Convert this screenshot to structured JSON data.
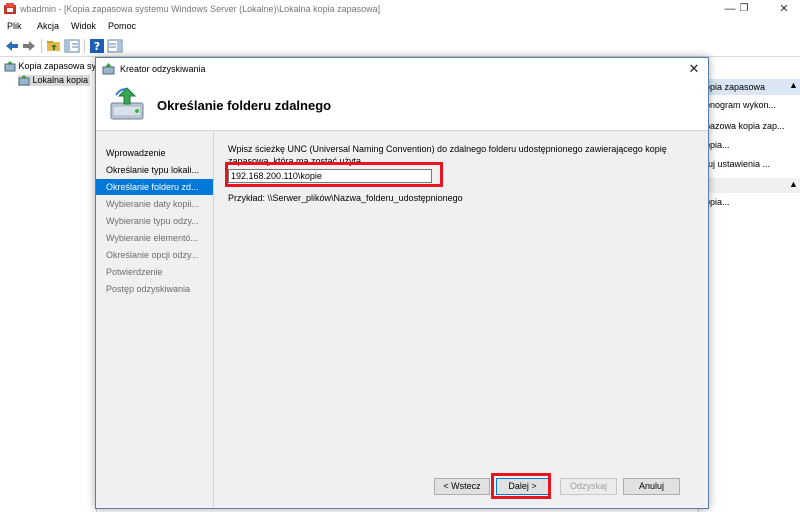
{
  "window": {
    "title": "wbadmin - [Kopia zapasowa systemu Windows Server (Lokalne)\\Lokalna kopia zapasowa]",
    "min_glyph": "—",
    "max_glyph": "❐",
    "close_glyph": "✕"
  },
  "menu": [
    "Plik",
    "Akcja",
    "Widok",
    "Pomoc"
  ],
  "tree": {
    "root": "Kopia zapasowa sy",
    "child": "Lokalna kopia"
  },
  "actions": {
    "header": "opia zapasowa",
    "items": [
      "onogram wykon...",
      "pazowa kopia zap...",
      "ppia...",
      "ruj ustawienia ...",
      "ppia..."
    ]
  },
  "dialog": {
    "title": "Kreator odzyskiwania",
    "close_glyph": "✕",
    "header_title": "Określanie folderu zdalnego",
    "steps": [
      "Wprowadzenie",
      "Określanie typu lokali...",
      "Określanie folderu zd...",
      "Wybieranie daty kopii...",
      "Wybieranie typu odzy...",
      "Wybieranie elementó...",
      "Określanie opcji odzy...",
      "Potwierdzenie",
      "Postęp odzyskiwania"
    ],
    "instruction": "Wpisz ścieżkę UNC (Universal Naming Convention) do zdalnego folderu udostępnionego zawierającego kopię zapasową, która ma zostać użyta.",
    "path_value": "192.168.200.110\\kopie",
    "example": "Przykład: \\\\Serwer_plików\\Nazwa_folderu_udostępnionego",
    "buttons": {
      "back": "< Wstecz",
      "next": "Dalej >",
      "recover": "Odzyskaj",
      "cancel": "Anuluj"
    }
  },
  "colors": {
    "highlight": "#e8141e",
    "selection": "#0078d7"
  }
}
